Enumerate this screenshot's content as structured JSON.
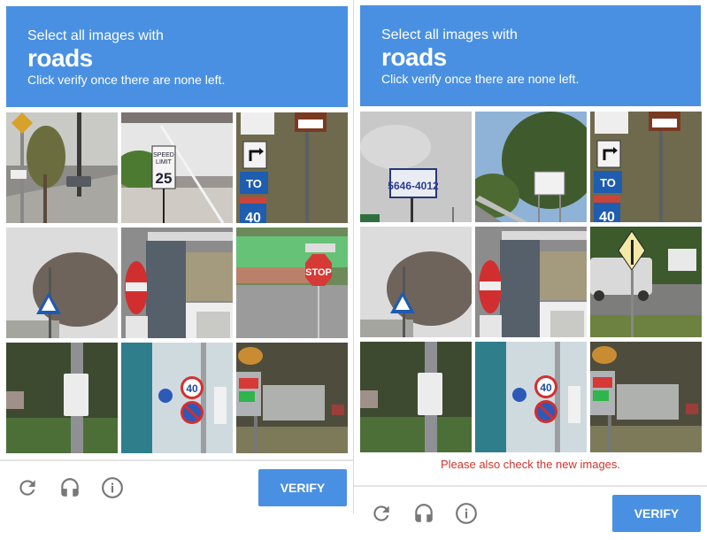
{
  "colors": {
    "accent": "#4a90e2",
    "error": "#d0342c",
    "icon": "#777777"
  },
  "panels": [
    {
      "header": {
        "line1": "Select all images with",
        "keyword": "roads",
        "line3": "Click verify once there are none left."
      },
      "tiles": [
        {
          "description": "street with yellow warning sign and cars"
        },
        {
          "description": "speed limit sign",
          "sign_text": "SPEED LIMIT 25"
        },
        {
          "description": "highway route signs",
          "sign_text": "TO 40"
        },
        {
          "description": "pedestrian crossing sign with bare tree"
        },
        {
          "description": "no entry sign on building"
        },
        {
          "description": "stop sign at intersection",
          "sign_text": "STOP"
        },
        {
          "description": "white sign on pole"
        },
        {
          "description": "speed limit 40 and no parking signs",
          "sign_text": "40"
        },
        {
          "description": "gas station price sign"
        }
      ],
      "footer": {
        "icons": [
          "reload-icon",
          "audio-headphones-icon",
          "info-icon"
        ],
        "verify_label": "VERIFY"
      }
    },
    {
      "header": {
        "line1": "Select all images with",
        "keyword": "roads",
        "line3": "Click verify once there are none left."
      },
      "tiles": [
        {
          "description": "billboard with phone number",
          "sign_text": "5646-4012"
        },
        {
          "description": "road sign beside highway with guardrail"
        },
        {
          "description": "highway route signs",
          "sign_text": "TO 40"
        },
        {
          "description": "pedestrian crossing sign with bare tree"
        },
        {
          "description": "no entry sign on building"
        },
        {
          "description": "merge sign with trucks on highway"
        },
        {
          "description": "white sign on pole"
        },
        {
          "description": "speed limit 40 and no parking signs",
          "sign_text": "40"
        },
        {
          "description": "gas station price sign"
        }
      ],
      "error_message": "Please also check the new images.",
      "footer": {
        "icons": [
          "reload-icon",
          "audio-headphones-icon",
          "info-icon"
        ],
        "verify_label": "VERIFY"
      }
    }
  ]
}
